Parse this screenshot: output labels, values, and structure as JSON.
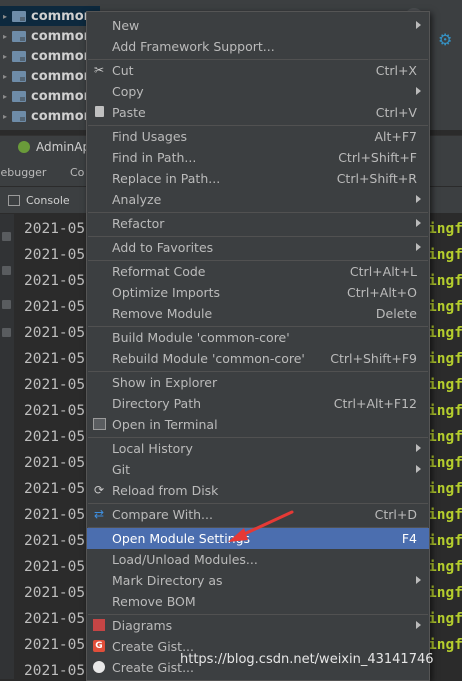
{
  "project_tree": {
    "rows": [
      "common-",
      "common-",
      "common-",
      "common-",
      "common-",
      "common-"
    ]
  },
  "run_panel": {
    "tab_label": "AdminAp",
    "sub_tabs": [
      "Debugger",
      "Co"
    ],
    "console_label": "Console"
  },
  "log": {
    "lines": [
      "2021-05",
      "2021-05",
      "2021-05",
      "2021-05",
      "2021-05",
      "2021-05",
      "2021-05",
      "2021-05",
      "2021-05",
      "2021-05",
      "2021-05",
      "2021-05",
      "2021-05",
      "2021-05",
      "2021-05",
      "2021-05",
      "2021-05",
      "2021-05"
    ],
    "right_fragments": [
      "ingf",
      "ingf",
      "ingf",
      "ingf",
      "ingf",
      "ingf",
      "ingf",
      "ingf",
      "ingf",
      "ingf",
      "ingf",
      "ingf",
      "ingf",
      "ingf",
      "ingf",
      "ingf",
      "ingf"
    ]
  },
  "menu": {
    "items": [
      {
        "label": "New",
        "shortcut": "",
        "submenu": true,
        "icon": ""
      },
      {
        "label": "Add Framework Support...",
        "shortcut": "",
        "submenu": false,
        "icon": ""
      },
      {
        "label": "Cut",
        "shortcut": "Ctrl+X",
        "submenu": false,
        "icon": "scissors-icon"
      },
      {
        "label": "Copy",
        "shortcut": "",
        "submenu": true,
        "icon": ""
      },
      {
        "label": "Paste",
        "shortcut": "Ctrl+V",
        "submenu": false,
        "icon": "clipboard-icon"
      },
      {
        "label": "Find Usages",
        "shortcut": "Alt+F7",
        "submenu": false,
        "icon": ""
      },
      {
        "label": "Find in Path...",
        "shortcut": "Ctrl+Shift+F",
        "submenu": false,
        "icon": ""
      },
      {
        "label": "Replace in Path...",
        "shortcut": "Ctrl+Shift+R",
        "submenu": false,
        "icon": ""
      },
      {
        "label": "Analyze",
        "shortcut": "",
        "submenu": true,
        "icon": ""
      },
      {
        "label": "Refactor",
        "shortcut": "",
        "submenu": true,
        "icon": ""
      },
      {
        "label": "Add to Favorites",
        "shortcut": "",
        "submenu": true,
        "icon": ""
      },
      {
        "label": "Reformat Code",
        "shortcut": "Ctrl+Alt+L",
        "submenu": false,
        "icon": ""
      },
      {
        "label": "Optimize Imports",
        "shortcut": "Ctrl+Alt+O",
        "submenu": false,
        "icon": ""
      },
      {
        "label": "Remove Module",
        "shortcut": "Delete",
        "submenu": false,
        "icon": ""
      },
      {
        "label": "Build Module 'common-core'",
        "shortcut": "",
        "submenu": false,
        "icon": ""
      },
      {
        "label": "Rebuild Module 'common-core'",
        "shortcut": "Ctrl+Shift+F9",
        "submenu": false,
        "icon": ""
      },
      {
        "label": "Show in Explorer",
        "shortcut": "",
        "submenu": false,
        "icon": ""
      },
      {
        "label": "Directory Path",
        "shortcut": "Ctrl+Alt+F12",
        "submenu": false,
        "icon": ""
      },
      {
        "label": "Open in Terminal",
        "shortcut": "",
        "submenu": false,
        "icon": "terminal-icon"
      },
      {
        "label": "Local History",
        "shortcut": "",
        "submenu": true,
        "icon": ""
      },
      {
        "label": "Git",
        "shortcut": "",
        "submenu": true,
        "icon": ""
      },
      {
        "label": "Reload from Disk",
        "shortcut": "",
        "submenu": false,
        "icon": "reload-icon"
      },
      {
        "label": "Compare With...",
        "shortcut": "Ctrl+D",
        "submenu": false,
        "icon": "compare-icon"
      },
      {
        "label": "Open Module Settings",
        "shortcut": "F4",
        "submenu": false,
        "icon": "",
        "highlighted": true
      },
      {
        "label": "Load/Unload Modules...",
        "shortcut": "",
        "submenu": false,
        "icon": ""
      },
      {
        "label": "Mark Directory as",
        "shortcut": "",
        "submenu": true,
        "icon": ""
      },
      {
        "label": "Remove BOM",
        "shortcut": "",
        "submenu": false,
        "icon": ""
      },
      {
        "label": "Diagrams",
        "shortcut": "",
        "submenu": true,
        "icon": "diagram-icon"
      },
      {
        "label": "Create Gist...",
        "shortcut": "",
        "submenu": false,
        "icon": "gist-icon"
      },
      {
        "label": "Create Gist...",
        "shortcut": "",
        "submenu": false,
        "icon": "github-icon"
      }
    ]
  },
  "watermark": "https://blog.csdn.net/weixin_43141746",
  "colors": {
    "menu_bg": "#3c3f41",
    "highlight": "#4b6eaf",
    "annotation_arrow": "#e53935"
  }
}
